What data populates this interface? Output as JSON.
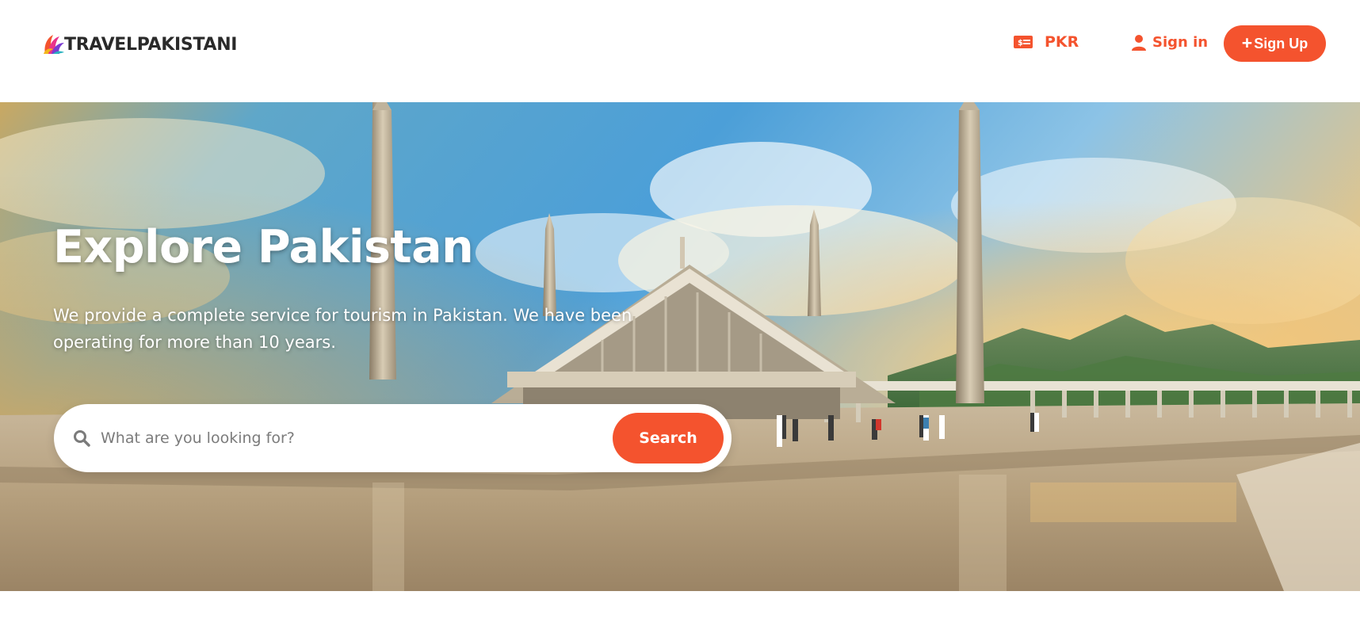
{
  "brand": {
    "name": "TRAVELPAKISTANI",
    "accent_color": "#f4532e"
  },
  "header": {
    "currency": {
      "icon": "money-bill-icon",
      "label": "PKR"
    },
    "signin": {
      "icon": "user-icon",
      "label": "Sign in"
    },
    "signup": {
      "icon": "plus-icon",
      "label": "Sign Up"
    }
  },
  "hero": {
    "title": "Explore Pakistan",
    "subtitle": "We provide a complete service for tourism in Pakistan. We have been operating for more than 10 years.",
    "background": "faisal-mosque-photo",
    "search": {
      "icon": "search-icon",
      "placeholder": "What are you looking for?",
      "value": "",
      "button_label": "Search"
    }
  }
}
